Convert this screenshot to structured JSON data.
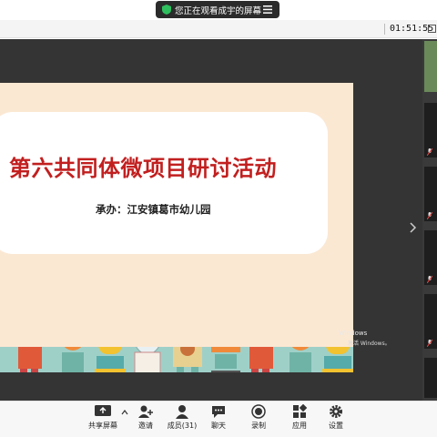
{
  "banner": {
    "text": "您正在观看成宇的屏幕",
    "shield_icon": "green-shield-icon",
    "menu_icon": "menu-icon"
  },
  "meeting": {
    "timer": "01:51:55"
  },
  "slide": {
    "title": "第六共同体微项目研讨活动",
    "subtitle": "承办：江安镇葛市幼儿园"
  },
  "watermark": {
    "line1": "Windows",
    "line2": "激活 Windows。"
  },
  "toolbar": {
    "share": "共享屏幕",
    "invite": "邀请",
    "members": "成员(31)",
    "chat": "聊天",
    "record": "录制",
    "apps": "应用",
    "settings": "设置"
  },
  "colors": {
    "title_red": "#c21f1f",
    "slide_bg": "#fbe8d3",
    "ground": "#9fd0c8",
    "stage": "#343434"
  }
}
